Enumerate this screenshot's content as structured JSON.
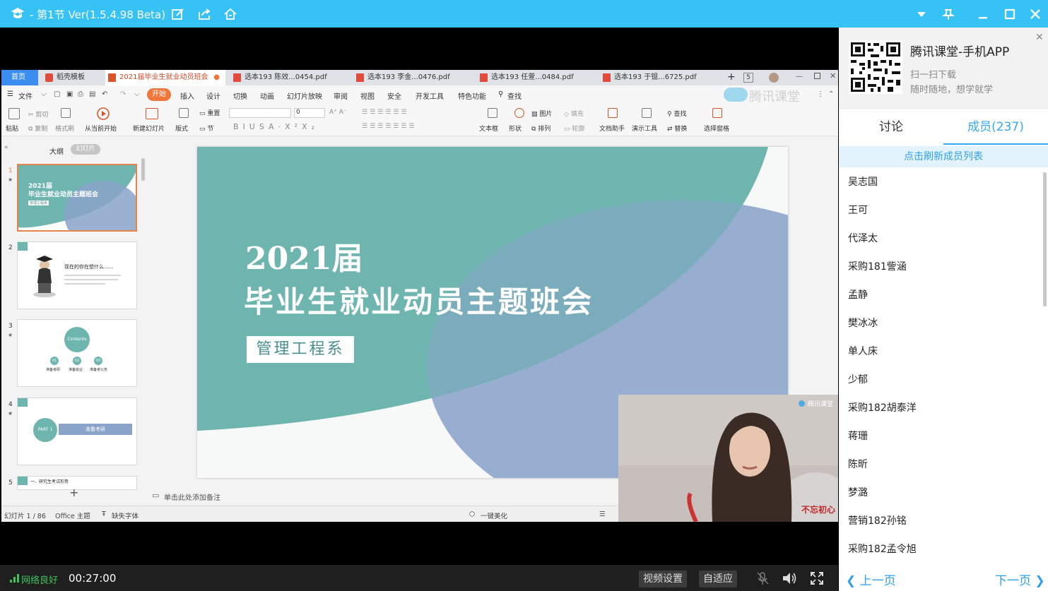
{
  "window": {
    "title": "- 第1节 Ver(1.5.4.98 Beta)",
    "icons": [
      "tencent-class-logo",
      "edit-icon",
      "share-icon",
      "home-icon",
      "dropdown-icon",
      "pin-icon",
      "minimize-icon",
      "maximize-icon",
      "close-icon"
    ]
  },
  "wps": {
    "tabs": [
      {
        "label": "首页"
      },
      {
        "label": "稻壳模板"
      },
      {
        "label": "2021届毕业生就业动员班会"
      },
      {
        "label": "选本193 陈效...0454.pdf"
      },
      {
        "label": "选本193 李金...0476.pdf"
      },
      {
        "label": "选本193 任萱...0484.pdf"
      },
      {
        "label": "选本193 于锟...6725.pdf"
      }
    ],
    "tab_count": "5",
    "menu": [
      "文件",
      "开始",
      "插入",
      "设计",
      "切换",
      "动画",
      "幻灯片放映",
      "审阅",
      "视图",
      "安全",
      "开发工具",
      "特色功能",
      "查找"
    ],
    "ribbon": {
      "paste": "粘贴",
      "cut": "剪切",
      "copy": "复制",
      "format_painter": "格式刷",
      "play_from_current": "从当前开始",
      "new_slide": "新建幻灯片",
      "layout": "版式",
      "reset": "重置",
      "section": "节",
      "font_size": "0",
      "text_box": "文本框",
      "shape": "形状",
      "picture": "图片",
      "fill": "填充",
      "arrange": "排列",
      "outline": "轮廓",
      "doc_assistant": "文档助手",
      "present_tool": "演示工具",
      "find": "查找",
      "replace": "替换",
      "select_pane": "选择窗格"
    },
    "watermark": "腾讯课堂",
    "panel_tabs": {
      "outline": "大纲",
      "slides": "幻灯片"
    },
    "thumbnails": [
      {
        "num": "1",
        "year": "2021届",
        "title": "毕业生就业动员主题班会",
        "tag": "管理工程系"
      },
      {
        "num": "2",
        "title": "现在的你在想什么......"
      },
      {
        "num": "3",
        "title": "Contents",
        "items": [
          "01",
          "02",
          "03"
        ],
        "labels": [
          "准备考研",
          "准备就业",
          "准备考公务"
        ]
      },
      {
        "num": "4",
        "title": "PART 1",
        "subtitle": "准备考研"
      },
      {
        "num": "5",
        "title": "一、研究生考试形势"
      }
    ],
    "slide": {
      "year": "2021届",
      "title": "毕业生就业动员主题班会",
      "department": "管理工程系"
    },
    "notes_placeholder": "单击此处添加备注",
    "status": {
      "slide_index": "幻灯片 1 / 86",
      "theme": "Office 主题",
      "missing_font": "缺失字体",
      "beautify": "一键美化"
    },
    "colors": {
      "teal": "#6eb5b0",
      "blue": "#8aa3c9",
      "accent": "#f0763a"
    }
  },
  "webcam": {
    "badge": "腾讯课堂",
    "banner_text": "不忘初心"
  },
  "bottom": {
    "network": "网络良好",
    "timer": "00:27:00",
    "video_settings": "视频设置",
    "fit": "自适应"
  },
  "right_panel": {
    "app_title": "腾讯课堂-手机APP",
    "scan": "扫一扫下载",
    "slogan": "随时随地，想学就学",
    "tabs": {
      "discuss": "讨论",
      "members": "成员(237)"
    },
    "refresh": "点击刷新成员列表",
    "members": [
      "吴志国",
      "王可",
      "代泽太",
      "采购181訾涵",
      "孟静",
      "樊冰冰",
      "单人床",
      "少郁",
      "采购182胡泰洋",
      "蒋珊",
      "陈昕",
      "梦潞",
      "营销182孙铭",
      "采购182孟令旭"
    ],
    "prev": "上一页",
    "next": "下一页"
  }
}
